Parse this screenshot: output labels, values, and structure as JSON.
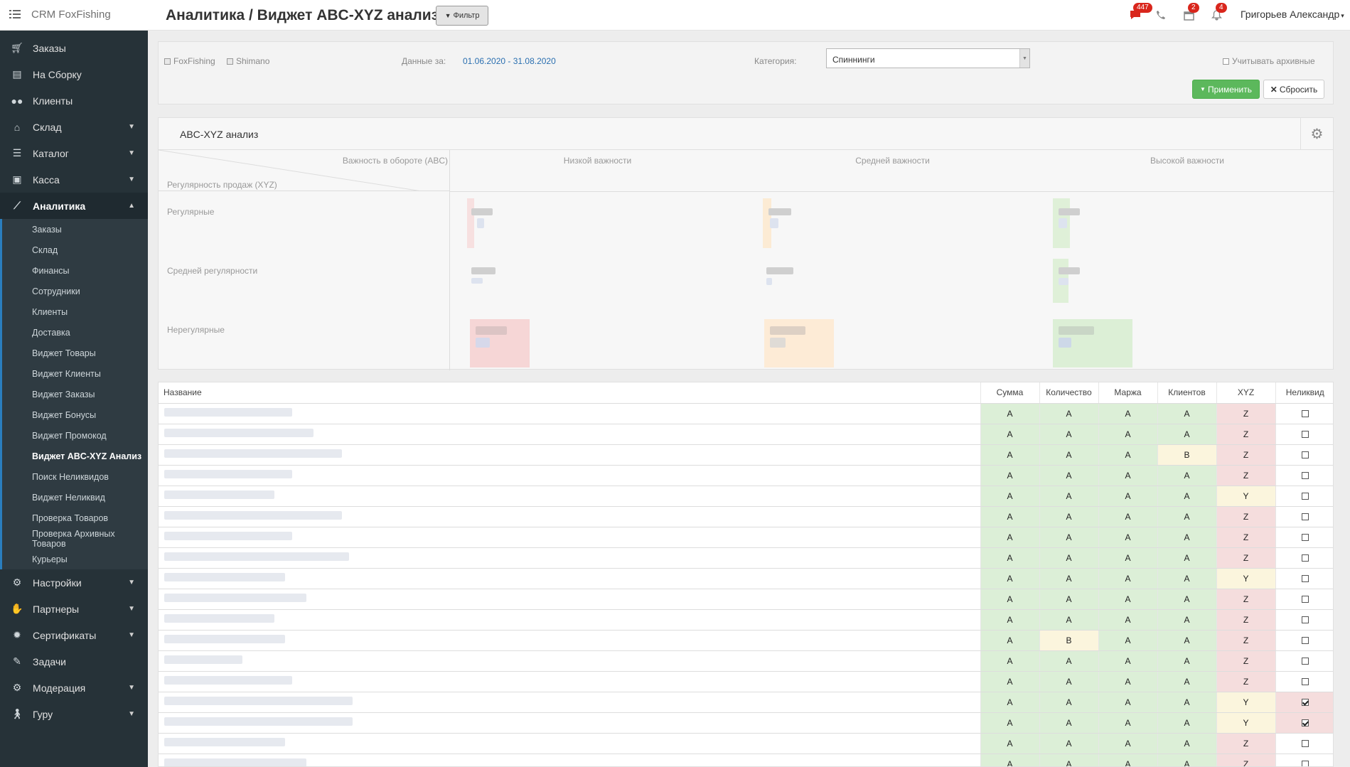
{
  "app": {
    "brand": "CRM FoxFishing",
    "title": "Аналитика / Виджет ABC-XYZ анализ",
    "filter_button": "Фильтр"
  },
  "topbar": {
    "chat_badge": "447",
    "calendar_badge": "2",
    "bell_badge": "4",
    "user": "Григорьев Александр"
  },
  "sidebar": {
    "items": [
      {
        "label": "Заказы",
        "icon": "cart-icon"
      },
      {
        "label": "На Сборку",
        "icon": "box-icon"
      },
      {
        "label": "Клиенты",
        "icon": "users-icon"
      },
      {
        "label": "Склад",
        "icon": "home-icon"
      },
      {
        "label": "Каталог",
        "icon": "list-icon"
      },
      {
        "label": "Касса",
        "icon": "money-icon"
      },
      {
        "label": "Аналитика",
        "icon": "chart-icon"
      }
    ],
    "sub_items": [
      "Заказы",
      "Склад",
      "Финансы",
      "Сотрудники",
      "Клиенты",
      "Доставка",
      "Виджет Товары",
      "Виджет Клиенты",
      "Виджет Заказы",
      "Виджет Бонусы",
      "Виджет Промокод",
      "Виджет ABC-XYZ Анализ",
      "Поиск Неликвидов",
      "Виджет Неликвид",
      "Проверка Товаров",
      "Проверка Архивных Товаров",
      "Курьеры"
    ],
    "bottom_items": [
      {
        "label": "Настройки",
        "icon": "gears-icon"
      },
      {
        "label": "Партнеры",
        "icon": "handshake-icon"
      },
      {
        "label": "Сертификаты",
        "icon": "certificate-icon"
      },
      {
        "label": "Задачи",
        "icon": "ticket-icon"
      },
      {
        "label": "Модерация",
        "icon": "gears-icon"
      },
      {
        "label": "Гуру",
        "icon": "walk-icon"
      }
    ]
  },
  "filter": {
    "brand1": "FoxFishing",
    "brand2": "Shimano",
    "period_label": "Данные за:",
    "period_value": "01.06.2020 - 31.08.2020",
    "category_label": "Категория:",
    "category_value": "Спиннинги",
    "archive_label": "Учитывать архивные",
    "apply": "Применить",
    "reset": "Сбросить"
  },
  "widget": {
    "title": "ABC-XYZ анализ",
    "abc_label": "Важность в обороте (ABC)",
    "xyz_label": "Регулярность продаж (XYZ)",
    "cols": [
      "Низкой важности",
      "Средней важности",
      "Высокой важности"
    ],
    "rows": [
      "Регулярные",
      "Средней регулярности",
      "Нерегулярные"
    ]
  },
  "table": {
    "headers": [
      "Название",
      "Сумма",
      "Количество",
      "Маржа",
      "Клиентов",
      "XYZ",
      "Неликвид"
    ],
    "rows": [
      [
        "A",
        "A",
        "A",
        "A",
        "Z",
        false
      ],
      [
        "A",
        "A",
        "A",
        "A",
        "Z",
        false
      ],
      [
        "A",
        "A",
        "A",
        "B",
        "Z",
        false
      ],
      [
        "A",
        "A",
        "A",
        "A",
        "Z",
        false
      ],
      [
        "A",
        "A",
        "A",
        "A",
        "Y",
        false
      ],
      [
        "A",
        "A",
        "A",
        "A",
        "Z",
        false
      ],
      [
        "A",
        "A",
        "A",
        "A",
        "Z",
        false
      ],
      [
        "A",
        "A",
        "A",
        "A",
        "Z",
        false
      ],
      [
        "A",
        "A",
        "A",
        "A",
        "Y",
        false
      ],
      [
        "A",
        "A",
        "A",
        "A",
        "Z",
        false
      ],
      [
        "A",
        "A",
        "A",
        "A",
        "Z",
        false
      ],
      [
        "A",
        "B",
        "A",
        "A",
        "Z",
        false
      ],
      [
        "A",
        "A",
        "A",
        "A",
        "Z",
        false
      ],
      [
        "A",
        "A",
        "A",
        "A",
        "Z",
        false
      ],
      [
        "A",
        "A",
        "A",
        "A",
        "Y",
        true
      ],
      [
        "A",
        "A",
        "A",
        "A",
        "Y",
        true
      ],
      [
        "A",
        "A",
        "A",
        "A",
        "Z",
        false
      ],
      [
        "A",
        "A",
        "A",
        "A",
        "Z",
        false
      ]
    ]
  },
  "colors": {
    "green": "#dcefd7",
    "yellow": "#fbf5dd",
    "red": "#f5dddd",
    "sidebar": "#263238",
    "accent": "#5cb85c"
  }
}
